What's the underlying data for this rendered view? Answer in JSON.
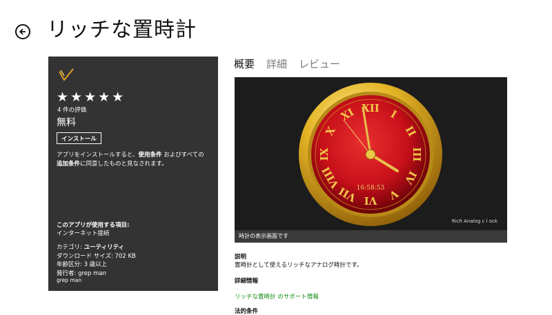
{
  "header": {
    "title": "リッチな置時計"
  },
  "side_panel": {
    "stars": "★★★★★",
    "rating_count": "4 件の評価",
    "price": "無料",
    "install_label": "インストール",
    "terms_part1": "アプリをインストールすると、",
    "terms_bold1": "使用条件",
    "terms_part2": " およびすべての",
    "terms_bold2": "追加条件",
    "terms_part3": "に同意したものと見なされます。",
    "permissions_heading": "このアプリが使用する項目:",
    "permissions_item": "インターネット接続",
    "category_label": "カテゴリ: ",
    "category_value": "ユーティリティ",
    "download_size": "ダウンロード サイズ: 702 KB",
    "age_rating": "年齢区分: 3 歳以上",
    "publisher": "発行者: grep man",
    "developer": "grep man"
  },
  "tabs": [
    {
      "label": "概要",
      "active": true
    },
    {
      "label": "詳細",
      "active": false
    },
    {
      "label": "レビュー",
      "active": false
    }
  ],
  "screenshot": {
    "clock_time": "16:58:53",
    "numerals": [
      "XII",
      "I",
      "II",
      "III",
      "IV",
      "V",
      "VI",
      "VII",
      "VIII",
      "IX",
      "X",
      "XI"
    ],
    "watermark": "Rich Analog c l ock",
    "caption": "時計の表示画面です",
    "colors": {
      "face": "#c8101a",
      "rim": "#d9a520",
      "background": "#1c1c1c"
    }
  },
  "description": {
    "heading": "説明",
    "body": "置時計として使えるリッチなアナログ時計です。",
    "details_heading": "詳細情報",
    "support_link": "リッチな置時計 のサポート情報",
    "cut_heading": "法的条件"
  },
  "colors": {
    "panel_bg": "#333333",
    "link_green": "#118a11"
  }
}
